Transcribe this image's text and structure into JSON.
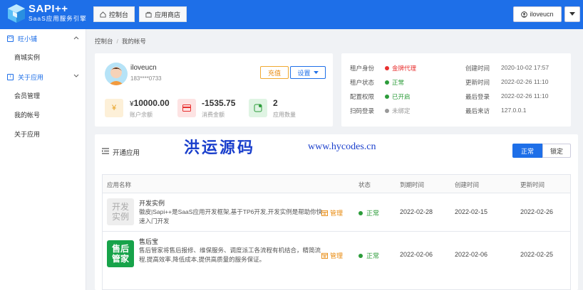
{
  "brand": {
    "name": "SAPI++",
    "subtitle": "SaaS应用服务引擎"
  },
  "topnav": {
    "console": "控制台",
    "store": "应用商店"
  },
  "user": {
    "menu_label": "iloveucn"
  },
  "sidebar": {
    "groups": [
      {
        "label": "旺小铺",
        "items": [
          "商城实例"
        ]
      },
      {
        "label": "关于应用",
        "items": [
          "会员管理",
          "我的帐号",
          "关于应用"
        ]
      }
    ]
  },
  "breadcrumb": {
    "home": "控制台",
    "sep": "/",
    "current": "我的帐号"
  },
  "profile": {
    "name": "iloveucn",
    "phone": "183****0733",
    "charge_btn": "充值",
    "settings_btn": "设置",
    "stats": [
      {
        "icon": "yen-icon",
        "value": "10000.00",
        "currency": "¥",
        "label": "账户余额"
      },
      {
        "icon": "card-icon",
        "value": "-1535.75",
        "label": "消费金额"
      },
      {
        "icon": "app-count-icon",
        "value": "2",
        "label": "应用数量"
      }
    ]
  },
  "account_info": {
    "left": [
      {
        "label": "租户身份",
        "value": "金牌代理",
        "color": "#e8302f"
      },
      {
        "label": "租户状态",
        "value": "正常",
        "color": "#2c9c3a"
      },
      {
        "label": "配置权限",
        "value": "已开启",
        "color": "#2c9c3a"
      },
      {
        "label": "扫码登录",
        "value": "未绑定",
        "color": "#999999"
      }
    ],
    "right": [
      {
        "label": "创建时间",
        "value": "2020-10-02 17:57"
      },
      {
        "label": "更新时间",
        "value": "2022-02-26 11:10"
      },
      {
        "label": "最后登录",
        "value": "2022-02-26 11:10"
      },
      {
        "label": "最后来访",
        "value": "127.0.0.1"
      }
    ]
  },
  "apps_panel": {
    "title": "开通应用",
    "filter_normal": "正常",
    "filter_locked": "锁定",
    "watermark_cn": "洪运源码",
    "watermark_url": "www.hycodes.cn",
    "columns": [
      "应用名称",
      "状态",
      "到期时间",
      "创建时间",
      "更新时间"
    ],
    "rows": [
      {
        "logo_text": [
          "开发",
          "实例"
        ],
        "name": "开发实例",
        "desc": "徽皮|Sapi++是SaaS应用开发框架,基于TP6开发,开发实例是帮助你快速入门开发",
        "manage": "管理",
        "status": "正常",
        "expire": "2022-02-28",
        "created": "2022-02-15",
        "updated": "2022-02-26"
      },
      {
        "logo_text": [
          "售后",
          "管家"
        ],
        "name": "售后宝",
        "desc": "售后管家将售后报修、维保服务、调度派工各流程有机结合，精简流程,提高效率,降低成本,提供高质量的服务保证。",
        "manage": "管理",
        "status": "正常",
        "expire": "2022-02-06",
        "created": "2022-02-06",
        "updated": "2022-02-25"
      }
    ]
  },
  "colors": {
    "primary": "#1e6fe8",
    "warning": "#e8890c",
    "success": "#2c9c3a",
    "danger": "#e8302f"
  }
}
